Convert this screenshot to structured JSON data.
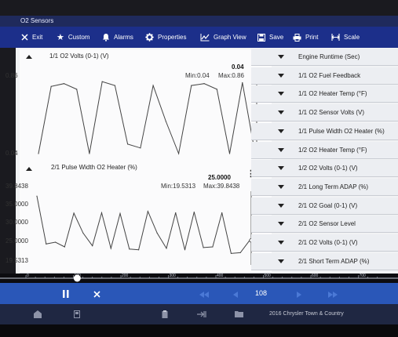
{
  "window": {
    "title": "O2 Sensors"
  },
  "toolbar": {
    "exit": "Exit",
    "custom": "Custom",
    "alarms": "Alarms",
    "properties": "Properties",
    "graph_view": "Graph View",
    "save": "Save",
    "print": "Print",
    "scale": "Scale"
  },
  "graphs": [
    {
      "title": "1/1 O2 Volts (0-1) (V)",
      "current_value": "0.04",
      "min_label": "Min:0.04",
      "max_label": "Max:0.86",
      "y_ticks": [
        "0.86",
        "0.04"
      ],
      "ylim": [
        0.04,
        0.86
      ],
      "samples": [
        0.04,
        0.75,
        0.78,
        0.72,
        0.04,
        0.8,
        0.76,
        0.14,
        0.1,
        0.76,
        0.38,
        0.04,
        0.76,
        0.78,
        0.72,
        0.04,
        0.79,
        0.04
      ]
    },
    {
      "title": "2/1 Pulse Width O2 Heater (%)",
      "current_value": "25.0000",
      "min_label": "Min:19.5313",
      "max_label": "Max:39.8438",
      "y_ticks": [
        "39.8438",
        "35.0000",
        "30.0000",
        "25.0000",
        "19.5313"
      ],
      "ylim": [
        19.5313,
        39.8438
      ],
      "samples": [
        37.2,
        24.0,
        24.5,
        23.2,
        32.5,
        27.0,
        23.5,
        32.6,
        22.8,
        32.4,
        22.6,
        22.4,
        33.0,
        27.0,
        22.8,
        32.6,
        22.4,
        32.8,
        23.0,
        23.2,
        32.6,
        21.4,
        21.6,
        25.0
      ]
    }
  ],
  "sensors": [
    "Engine Runtime (Sec)",
    "1/1 O2 Fuel Feedback",
    "1/1 O2 Heater Temp (°F)",
    "1/1 O2 Sensor Volts (V)",
    "1/1 Pulse Width O2 Heater (%)",
    "1/2 O2 Heater Temp (°F)",
    "1/2 O2 Volts (0-1) (V)",
    "2/1 Long Term ADAP (%)",
    "2/1 O2 Goal (0-1) (V)",
    "2/1 O2 Sensor Level",
    "2/1 O2 Volts (0-1) (V)",
    "2/1 Short Term ADAP (%)"
  ],
  "timeline": {
    "ticks": [
      "0",
      "100",
      "200",
      "300",
      "400",
      "500",
      "600",
      "700"
    ],
    "position": 108,
    "max": 750
  },
  "navbar": {
    "frame": "108"
  },
  "status": {
    "vehicle": "2016 Chrysler Town & Country"
  },
  "colors": {
    "toolbar": "#1c2f8a",
    "navbar": "#2a57b8",
    "title": "#1f2a5c"
  }
}
